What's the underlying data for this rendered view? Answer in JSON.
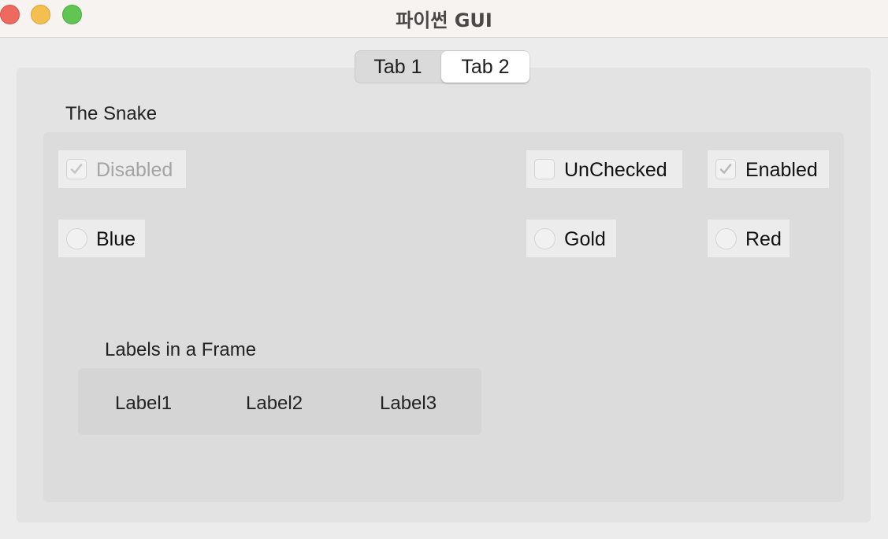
{
  "window": {
    "title": "파이썬 GUI"
  },
  "tabs": [
    {
      "label": "Tab 1",
      "selected": false
    },
    {
      "label": "Tab 2",
      "selected": true
    }
  ],
  "snake_group": {
    "title": "The Snake",
    "checkboxes": [
      {
        "label": "Disabled",
        "checked": true,
        "enabled": false
      },
      {
        "label": "UnChecked",
        "checked": false,
        "enabled": true
      },
      {
        "label": "Enabled",
        "checked": true,
        "enabled": true
      }
    ],
    "radios": [
      {
        "label": "Blue",
        "selected": false
      },
      {
        "label": "Gold",
        "selected": false
      },
      {
        "label": "Red",
        "selected": false
      }
    ]
  },
  "labels_frame": {
    "title": "Labels in a Frame",
    "labels": [
      "Label1",
      "Label2",
      "Label3"
    ]
  },
  "colors": {
    "close": "#ee6a5e",
    "minimize": "#f5bf4f",
    "maximize": "#61c554",
    "checkmark": "#b9b9b9"
  }
}
